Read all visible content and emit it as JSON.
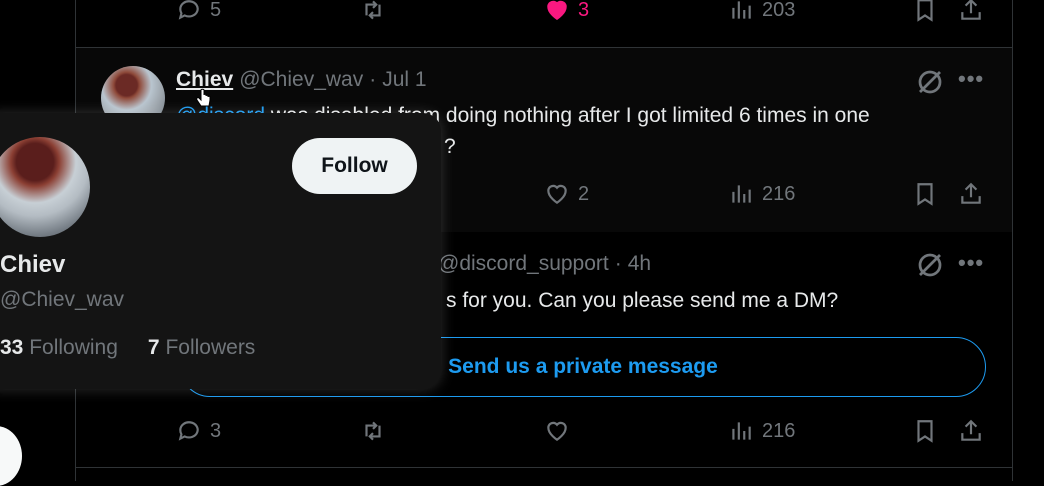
{
  "tweet1": {
    "reply_count": "5",
    "retweet_count": "",
    "like_count": "3",
    "view_count": "203"
  },
  "tweet2": {
    "author_name": "Chiev",
    "author_handle": "@Chiev_wav",
    "separator": "·",
    "timestamp": "Jul 1",
    "mention": "@discord",
    "text_line1": " was disabled from doing nothing after I got limited 6 times in one",
    "text_line2": "?",
    "like_count": "2",
    "view_count": "216"
  },
  "tweet3": {
    "author_handle": "@discord_support",
    "separator": "·",
    "timestamp": "4h",
    "text_visible": "s for you. Can you please send me a DM?",
    "cta_label": "Send us a private message",
    "reply_count": "3",
    "view_count": "216"
  },
  "hovercard": {
    "name": "Chiev",
    "handle": "@Chiev_wav",
    "follow_label": "Follow",
    "following_count": "33",
    "following_label": "Following",
    "followers_count": "7",
    "followers_label": "Followers"
  },
  "colors": {
    "accent": "#1d9bf0",
    "like": "#f91880",
    "muted": "#71767b",
    "text": "#e7e9ea"
  }
}
